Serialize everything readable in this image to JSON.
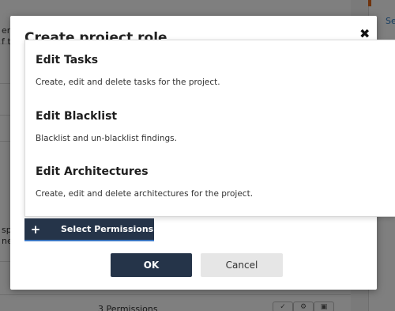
{
  "background": {
    "left_text_lines": [
      "erm",
      "f th",
      "sp",
      "ned"
    ],
    "side_link": "Se",
    "footer_text": "3 Permissions"
  },
  "modal": {
    "title": "Create project role",
    "close_icon": "close-icon",
    "permissions": [
      {
        "title": "Edit Tasks",
        "description": "Create, edit and delete tasks for the project."
      },
      {
        "title": "Edit Blacklist",
        "description": "Blacklist and un-blacklist findings."
      },
      {
        "title": "Edit Architectures",
        "description": "Create, edit and delete architectures for the project."
      }
    ],
    "select_permissions_label": "Select Permissions",
    "ok_label": "OK",
    "cancel_label": "Cancel"
  },
  "colors": {
    "primary": "#253449",
    "secondary": "#e6e6e6",
    "accent_link": "#2b79c2",
    "accent_orange": "#e0661a"
  }
}
